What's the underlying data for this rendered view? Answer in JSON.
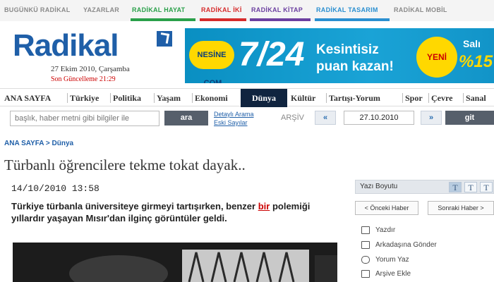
{
  "topnav": {
    "items": [
      {
        "label": "BUGÜNKÜ RADİKAL",
        "color": "#8a8a8a"
      },
      {
        "label": "YAZARLAR",
        "color": "#8a8a8a"
      },
      {
        "label": "RADİKAL HAYAT",
        "color": "#2aa04a"
      },
      {
        "label": "RADİKAL İKİ",
        "color": "#d62b2b"
      },
      {
        "label": "RADİKAL KİTAP",
        "color": "#6b3fa0"
      },
      {
        "label": "RADİKAL TASARIM",
        "color": "#2a8fd0"
      },
      {
        "label": "RADİKAL MOBİL",
        "color": "#8a8a8a"
      }
    ]
  },
  "brand": {
    "logo": "Radikal",
    "date": "27  Ekim 2010, Çarşamba",
    "updated": "Son Güncelleme 21:29"
  },
  "ad": {
    "brand": "NESİNE .COM",
    "big": "7/24",
    "line1": "Kesintisiz",
    "line2": "puan kazan!",
    "badge": "YENİ",
    "day": "Salı",
    "percent": "%15"
  },
  "mainnav": {
    "items": [
      "ANA SAYFA",
      "Türkiye",
      "Politika",
      "Yaşam",
      "Ekonomi",
      "Dünya",
      "Kültür",
      "Tartışı-Yorum",
      "Spor",
      "Çevre",
      "Sanal"
    ],
    "active": "Dünya"
  },
  "search": {
    "placeholder": "başlık, haber metni gibi bilgiler ile",
    "button": "ara",
    "links": [
      "Detaylı Arama",
      "Eski Sayılar"
    ],
    "archive_label": "ARŞİV",
    "prev": "«",
    "date": "27.10.2010",
    "next": "»",
    "go": "git"
  },
  "article": {
    "breadcrumb": "ANA SAYFA > Dünya",
    "title": "Türbanlı öğrencilere tekme tokat dayak..",
    "timestamp": "14/10/2010 13:58",
    "lead_before": "Türkiye türbanla üniversiteye girmeyi tartışırken, benzer",
    "lead_link": "bir",
    "lead_after": "polemiği yıllardır yaşayan Mısır'dan ilginç görüntüler geldi."
  },
  "sidebar": {
    "font_size_label": "Yazı Boyutu",
    "sizes": [
      "T",
      "T",
      "T"
    ],
    "prev_news": "< Önceki Haber",
    "next_news": "Sonraki Haber >",
    "actions": [
      {
        "label": "Yazdır",
        "icon": "printer-icon"
      },
      {
        "label": "Arkadaşına Gönder",
        "icon": "envelope-icon"
      },
      {
        "label": "Yorum Yaz",
        "icon": "comment-icon"
      },
      {
        "label": "Arşive Ekle",
        "icon": "archive-icon"
      }
    ]
  }
}
